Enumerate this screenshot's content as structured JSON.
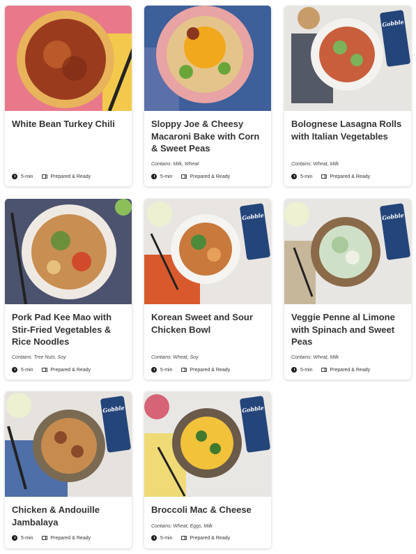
{
  "brand": "Gobble",
  "cards": [
    {
      "title": "White Bean Turkey Chili",
      "contains": "",
      "time": "5-min",
      "prep": "Prepared & Ready"
    },
    {
      "title": "Sloppy Joe & Cheesy Macaroni Bake with Corn & Sweet Peas",
      "contains": "Contains: Milk, Wheat",
      "time": "5-min",
      "prep": "Prepared & Ready"
    },
    {
      "title": "Bolognese Lasagna Rolls with Italian Vegetables",
      "contains": "Contains: Wheat, Milk",
      "time": "5-min",
      "prep": "Prepared & Ready"
    },
    {
      "title": "Pork Pad Kee Mao with Stir-Fried Vegetables & Rice Noodles",
      "contains": "Contains: Tree Nuts, Soy",
      "time": "5-min",
      "prep": "Prepared & Ready"
    },
    {
      "title": "Korean Sweet and Sour Chicken Bowl",
      "contains": "Contains: Wheat, Soy",
      "time": "5-min",
      "prep": "Prepared & Ready"
    },
    {
      "title": "Veggie Penne al Limone with Spinach and Sweet Peas",
      "contains": "Contains: Wheat, Milk",
      "time": "5-min",
      "prep": "Prepared & Ready"
    },
    {
      "title": "Chicken & Andouille Jambalaya",
      "contains": "",
      "time": "5-min",
      "prep": "Prepared & Ready"
    },
    {
      "title": "Broccoli Mac & Cheese",
      "contains": "Contains: Wheat, Eggs, Milk",
      "time": "5-min",
      "prep": "Prepared & Ready"
    }
  ],
  "colors": {
    "brand_blue": "#24457a",
    "card_shadow": "rgba(0,0,0,0.18)"
  }
}
